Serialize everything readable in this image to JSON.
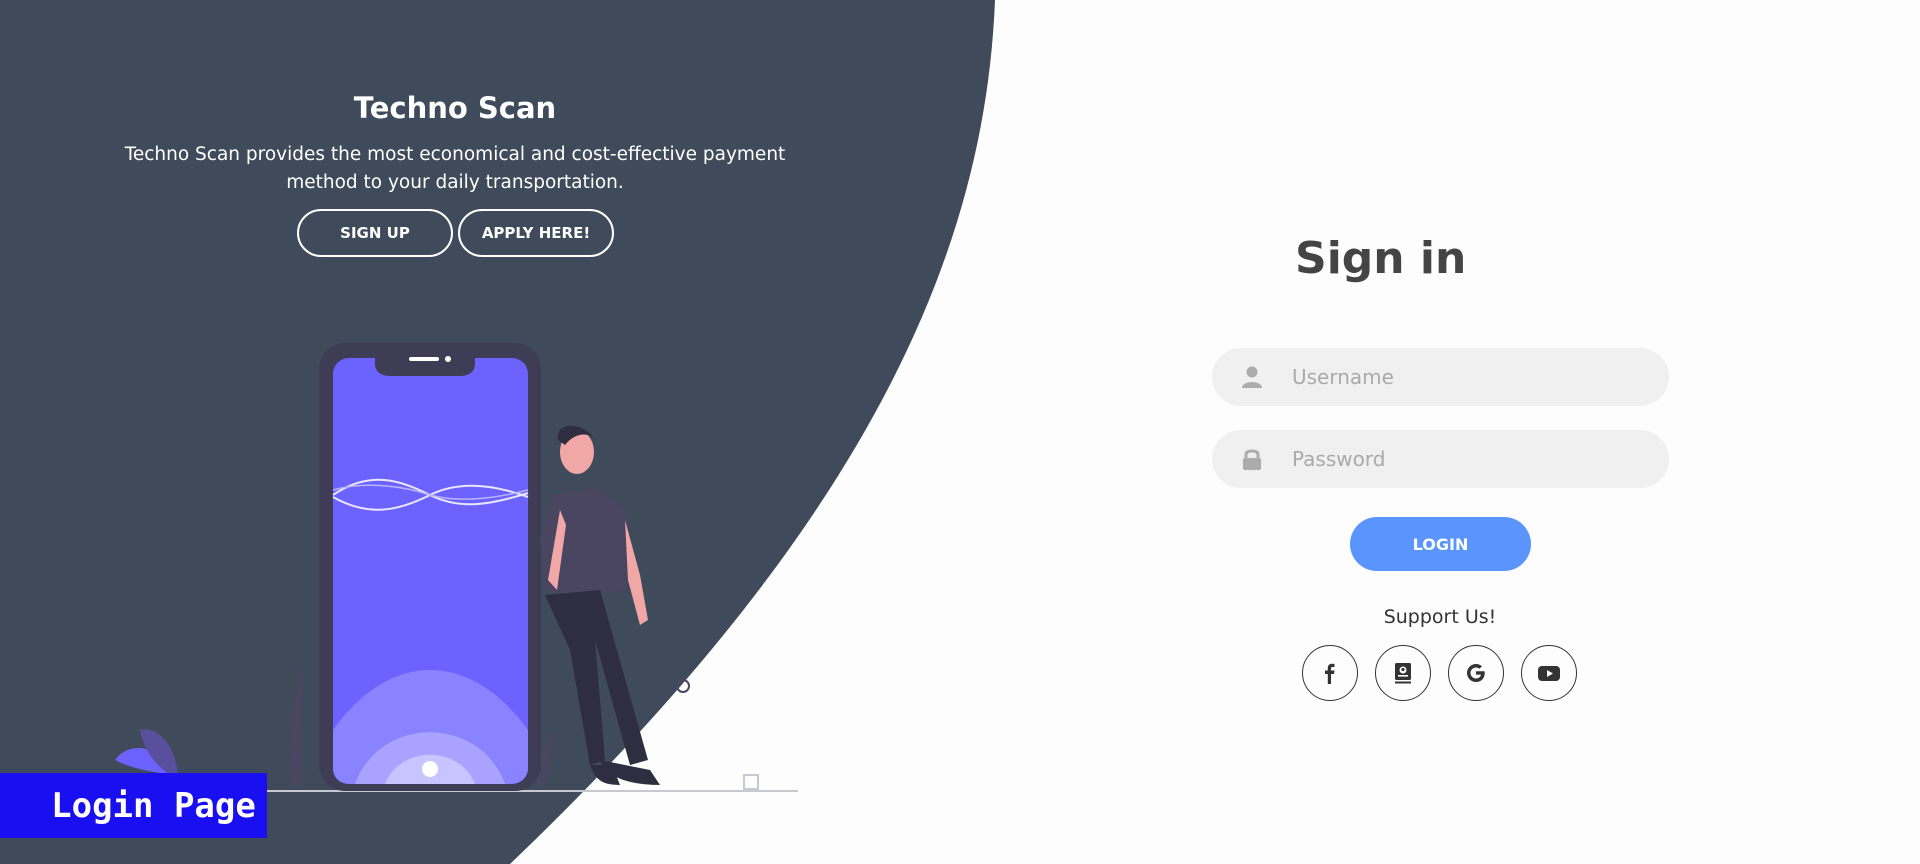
{
  "hero": {
    "title": "Techno Scan",
    "description": "Techno Scan provides the most economical and cost-effective payment method to your daily transportation.",
    "signup_label": "SIGN UP",
    "apply_label": "APPLY HERE!"
  },
  "signin": {
    "title": "Sign in",
    "username_placeholder": "Username",
    "password_placeholder": "Password",
    "login_label": "LOGIN",
    "support_text": "Support Us!"
  },
  "social": [
    {
      "icon": "facebook-icon"
    },
    {
      "icon": "contact-book-icon"
    },
    {
      "icon": "google-icon"
    },
    {
      "icon": "youtube-icon"
    }
  ],
  "badge": {
    "label": "Login Page"
  },
  "colors": {
    "panel_dark": "#3f4b5b",
    "accent": "#5995fd",
    "phone_screen": "#6c63ff",
    "badge": "#1a0ff0"
  }
}
